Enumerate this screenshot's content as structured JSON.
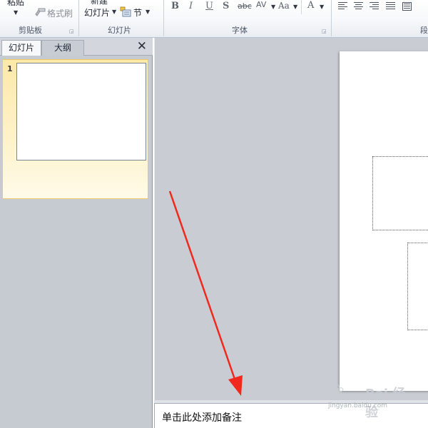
{
  "ribbon": {
    "clipboard": {
      "paste_label": "粘贴",
      "format_painter_label": "格式刷",
      "group_label": "剪贴板"
    },
    "slides": {
      "new_label_top": "新建",
      "new_label_bottom": "幻灯片",
      "section_label": "节",
      "group_label": "幻灯片"
    },
    "font": {
      "bold_label": "B",
      "italic_label": "I",
      "underline_label": "U",
      "shadow_label": "S",
      "strike_label": "abc",
      "spacing_label": "AV",
      "case_label": "Aa",
      "color_label": "A",
      "group_label": "字体"
    },
    "paragraph": {
      "group_label_partial": "段"
    }
  },
  "pane": {
    "tab_slides": "幻灯片",
    "tab_outline": "大纲",
    "close_symbol": "✕",
    "slide_number": "1"
  },
  "notes": {
    "placeholder": "单击此处添加备注"
  },
  "watermark": {
    "text": "Bai 经验",
    "url": "jingyan.baidu.com"
  },
  "colors": {
    "arrow": "#f0281e",
    "thumb_selected": "#fde9a7"
  }
}
